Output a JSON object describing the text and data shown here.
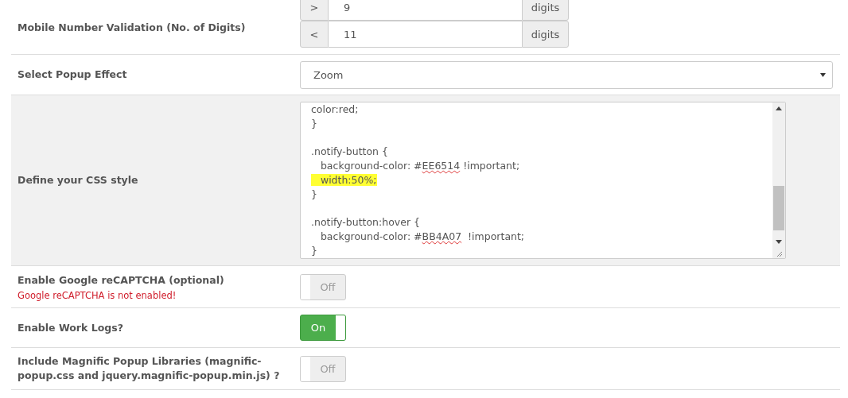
{
  "settings": [
    {
      "kind": "ranges",
      "label": "Mobile Number Validation (No. of Digits)",
      "shaded": false,
      "groups": [
        {
          "operator": ">",
          "value": "9",
          "unit": "digits"
        },
        {
          "operator": "<",
          "value": "11",
          "unit": "digits"
        }
      ]
    },
    {
      "kind": "select",
      "label": "Select Popup Effect",
      "shaded": false,
      "value": "Zoom"
    },
    {
      "kind": "code",
      "label": "Define your CSS style",
      "shaded": true,
      "lines": [
        {
          "kind": "code",
          "highlighted": false,
          "parts": [
            {
              "text": "color:red;",
              "misspelled": false
            }
          ]
        },
        {
          "kind": "code",
          "highlighted": false,
          "parts": [
            {
              "text": "}",
              "misspelled": false
            }
          ]
        },
        {
          "kind": "blank"
        },
        {
          "kind": "code",
          "highlighted": false,
          "parts": [
            {
              "text": ".notify-button {",
              "misspelled": false
            }
          ]
        },
        {
          "kind": "code",
          "highlighted": false,
          "parts": [
            {
              "text": "   background-color: #",
              "misspelled": false
            },
            {
              "text": "EE6514",
              "misspelled": true
            },
            {
              "text": " !important;",
              "misspelled": false
            }
          ]
        },
        {
          "kind": "code",
          "highlighted": true,
          "parts": [
            {
              "text": "   width:50%;",
              "misspelled": false
            }
          ]
        },
        {
          "kind": "code",
          "highlighted": false,
          "parts": [
            {
              "text": "}",
              "misspelled": false
            }
          ]
        },
        {
          "kind": "blank"
        },
        {
          "kind": "code",
          "highlighted": false,
          "parts": [
            {
              "text": ".notify-button:hover {",
              "misspelled": false
            }
          ]
        },
        {
          "kind": "code",
          "highlighted": false,
          "parts": [
            {
              "text": "   background-color: #",
              "misspelled": false
            },
            {
              "text": "BB4A07",
              "misspelled": true
            },
            {
              "text": "  !important;",
              "misspelled": false
            }
          ]
        },
        {
          "kind": "code",
          "highlighted": false,
          "parts": [
            {
              "text": "}",
              "misspelled": false
            }
          ]
        }
      ]
    },
    {
      "kind": "toggle",
      "label": "Enable Google reCAPTCHA (optional)",
      "shaded": false,
      "note": "Google reCAPTCHA is not enabled!",
      "on": false,
      "state_label": "Off"
    },
    {
      "kind": "toggle",
      "label": "Enable Work Logs?",
      "shaded": false,
      "on": true,
      "state_label": "On"
    },
    {
      "kind": "toggle",
      "label": "Include Magnific Popup Libraries (magnific-popup.css and jquery.magnific-popup.min.js) ?",
      "shaded": false,
      "on": false,
      "state_label": "Off"
    }
  ]
}
